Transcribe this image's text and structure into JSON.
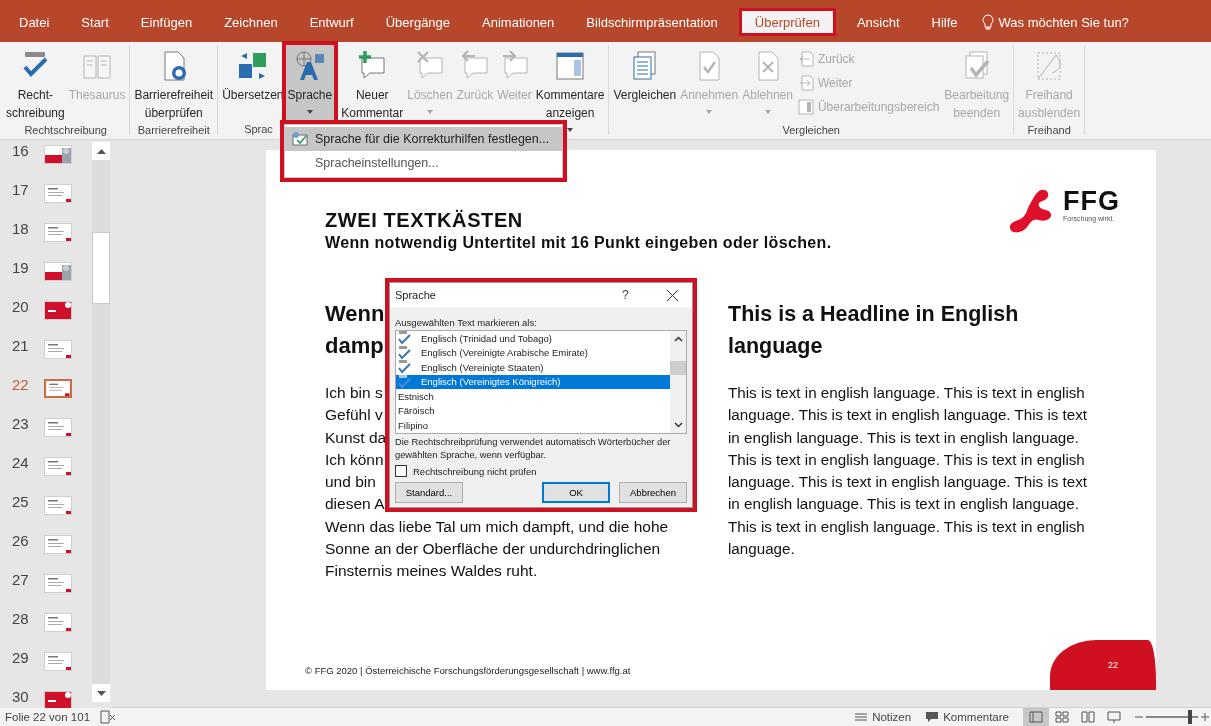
{
  "tabs": [
    {
      "label": "Datei",
      "selected": false
    },
    {
      "label": "Start",
      "selected": false
    },
    {
      "label": "Einfügen",
      "selected": false
    },
    {
      "label": "Zeichnen",
      "selected": false
    },
    {
      "label": "Entwurf",
      "selected": false
    },
    {
      "label": "Übergänge",
      "selected": false
    },
    {
      "label": "Animationen",
      "selected": false
    },
    {
      "label": "Bildschirmpräsentation",
      "selected": false
    },
    {
      "label": "Überprüfen",
      "selected": true,
      "highlighted": true
    },
    {
      "label": "Ansicht",
      "selected": false
    },
    {
      "label": "Hilfe",
      "selected": false
    }
  ],
  "tell_me": {
    "placeholder": "Was möchten Sie tun?"
  },
  "ribbon": {
    "groups": [
      {
        "label": "Rechtschreibung",
        "items": [
          {
            "kind": "large",
            "lines": [
              "Recht-",
              "schreibung"
            ],
            "disabled": false
          },
          {
            "kind": "large",
            "lines": [
              "Thesaurus"
            ],
            "disabled": true
          }
        ]
      },
      {
        "label": "Barrierefreiheit",
        "items": [
          {
            "kind": "large",
            "lines": [
              "Barrierefreiheit",
              "überprüfen"
            ],
            "disabled": false
          }
        ]
      },
      {
        "label": "Sprac",
        "items": [
          {
            "kind": "large",
            "lines": [
              "Übersetzen"
            ],
            "disabled": false
          },
          {
            "kind": "large",
            "lines": [
              "Sprache"
            ],
            "disabled": false,
            "dropdown": true,
            "pressed": true,
            "highlighted": true
          }
        ]
      },
      {
        "items": [
          {
            "kind": "large",
            "lines": [
              "Neuer",
              "Kommentar"
            ],
            "disabled": false
          },
          {
            "kind": "large",
            "lines": [
              "Löschen"
            ],
            "disabled": true,
            "dropdown": true
          },
          {
            "kind": "large",
            "lines": [
              "Zurück"
            ],
            "disabled": true
          },
          {
            "kind": "large",
            "lines": [
              "Weiter"
            ],
            "disabled": true
          },
          {
            "kind": "large",
            "lines": [
              "Kommentare",
              "anzeigen"
            ],
            "disabled": false,
            "dropdown": true
          }
        ]
      },
      {
        "label": "Vergleichen",
        "items": [
          {
            "kind": "large",
            "lines": [
              "Vergleichen"
            ],
            "disabled": false
          },
          {
            "kind": "large",
            "lines": [
              "Annehmen"
            ],
            "disabled": true,
            "dropdown": true
          },
          {
            "kind": "large",
            "lines": [
              "Ablehnen"
            ],
            "disabled": true,
            "dropdown": true
          },
          {
            "kind": "stack",
            "entries": [
              {
                "label": "Zurück",
                "disabled": true
              },
              {
                "label": "Weiter",
                "disabled": true
              },
              {
                "label": "Überarbeitungsbereich",
                "disabled": true
              }
            ]
          },
          {
            "kind": "large",
            "lines": [
              "Bearbeitung",
              "beenden"
            ],
            "disabled": true
          }
        ]
      },
      {
        "label": "Freihand",
        "items": [
          {
            "kind": "large",
            "lines": [
              "Freihand",
              "ausblenden"
            ],
            "disabled": true
          }
        ]
      }
    ]
  },
  "language_menu": {
    "highlighted": true,
    "items": [
      {
        "label": "Sprache für die Korrekturhilfen festlegen...",
        "selected": true
      },
      {
        "label": "Spracheinstellungen...",
        "selected": false
      }
    ]
  },
  "slides_panel": [
    {
      "number": "16",
      "kind": "photo",
      "selected": false
    },
    {
      "number": "17",
      "kind": "text",
      "selected": false
    },
    {
      "number": "18",
      "kind": "text",
      "selected": false
    },
    {
      "number": "19",
      "kind": "photo",
      "selected": false
    },
    {
      "number": "20",
      "kind": "red",
      "selected": false
    },
    {
      "number": "21",
      "kind": "text",
      "selected": false
    },
    {
      "number": "22",
      "kind": "text",
      "selected": true
    },
    {
      "number": "23",
      "kind": "text",
      "selected": false
    },
    {
      "number": "24",
      "kind": "text",
      "selected": false
    },
    {
      "number": "25",
      "kind": "text",
      "selected": false
    },
    {
      "number": "26",
      "kind": "text",
      "selected": false
    },
    {
      "number": "27",
      "kind": "text",
      "selected": false
    },
    {
      "number": "28",
      "kind": "text",
      "selected": false
    },
    {
      "number": "29",
      "kind": "text",
      "selected": false
    },
    {
      "number": "30",
      "kind": "red",
      "selected": false
    }
  ],
  "slide": {
    "title": "ZWEI TEXTKÄSTEN",
    "subtitle": "Wenn notwendig Untertitel mit 16 Punkt eingeben oder löschen.",
    "logo": {
      "name": "FFG",
      "tagline": "Forschung wirkt."
    },
    "left_column": {
      "heading_lines": [
        "Wenn",
        "damp"
      ],
      "lines": [
        "Ich bin s",
        "Gefühl v",
        "Kunst da",
        "Ich könn",
        "und bin",
        "diesen A",
        "Wenn das liebe Tal um mich dampft, und die hohe",
        "Sonne an der Oberfläche der undurchdringlichen",
        "Finsternis meines Waldes ruht."
      ]
    },
    "right_column": {
      "heading": "This is a Headline in English language",
      "body": "This is text in english language. This is text in english language. This is text in english language. This is text in english language. This is text in english language. This is text in english language. This is text in english language. This is text in english language. This is text in english language. This is text in english language. This is text in english language. This is text in english language."
    },
    "footer": "© FFG 2020 | Österreichische Forschungsförderungsgesellschaft | www.ffg.at",
    "page_number": "22"
  },
  "dialog": {
    "title": "Sprache",
    "help": "?",
    "highlighted": true,
    "list_label": "Ausgewählten Text markieren als:",
    "languages": [
      {
        "label": "Englisch (Trinidad und Tobago)",
        "spellcheck": true,
        "selected": false
      },
      {
        "label": "Englisch (Vereinigte Arabische Emirate)",
        "spellcheck": true,
        "selected": false
      },
      {
        "label": "Englisch (Vereinigte Staaten)",
        "spellcheck": true,
        "selected": false
      },
      {
        "label": "Englisch (Vereinigtes Königreich)",
        "spellcheck": true,
        "selected": true
      },
      {
        "label": "Estnisch",
        "spellcheck": false,
        "selected": false
      },
      {
        "label": "Färöisch",
        "spellcheck": false,
        "selected": false
      },
      {
        "label": "Filipino",
        "spellcheck": false,
        "selected": false
      }
    ],
    "note": "Die Rechtschreibprüfung verwendet automatisch Wörterbücher der gewählten Sprache, wenn verfügbar.",
    "checkbox": {
      "label": "Rechtschreibung nicht prüfen",
      "checked": false
    },
    "buttons": [
      {
        "label": "Standard...",
        "default": false
      },
      {
        "label": "OK",
        "default": true
      },
      {
        "label": "Abbrechen",
        "default": false
      }
    ]
  },
  "status_bar": {
    "slide_info": "Folie 22 von 101",
    "notes": "Notizen",
    "comments": "Kommentare",
    "views": [
      {
        "selected": true
      },
      {
        "selected": false
      },
      {
        "selected": false
      },
      {
        "selected": false
      }
    ],
    "zoom": {
      "level": 0.85
    }
  }
}
